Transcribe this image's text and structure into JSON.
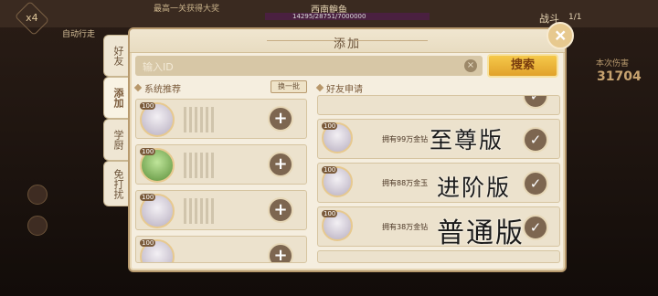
{
  "background": {
    "speed_label": "x4",
    "auto_label": "自动行走",
    "top_text": "最高一关获得大奖",
    "boss_name": "西南鲍鱼",
    "boss_hp": "14295/28751/7000000",
    "battle_label": "战斗",
    "round_label": "1/1",
    "damage_label": "本次伤害",
    "damage_value": "31704"
  },
  "tabs": [
    {
      "label": "好友",
      "active": false
    },
    {
      "label": "添加",
      "active": true
    },
    {
      "label": "学厨",
      "active": false
    },
    {
      "label": "免打扰",
      "active": false
    }
  ],
  "dialog": {
    "title": "添加",
    "close_icon": "close-icon"
  },
  "search": {
    "placeholder": "输入ID",
    "button": "搜索"
  },
  "recommend": {
    "header": "系统推荐",
    "refresh_label": "换一批",
    "level": "100",
    "items": [
      {
        "avatar": "white-hair-girl"
      },
      {
        "avatar": "green-hair-boy"
      },
      {
        "avatar": "silver-hair-girl"
      },
      {
        "avatar": "white-hair-girl"
      }
    ]
  },
  "requests": {
    "header": "好友申请",
    "level": "100",
    "items": [
      {
        "text": "拥有99万金钻"
      },
      {
        "text": "拥有88万金玉"
      },
      {
        "text": "拥有38万金钻"
      }
    ]
  },
  "overlays": [
    "至尊版",
    "进阶版",
    "普通版"
  ]
}
